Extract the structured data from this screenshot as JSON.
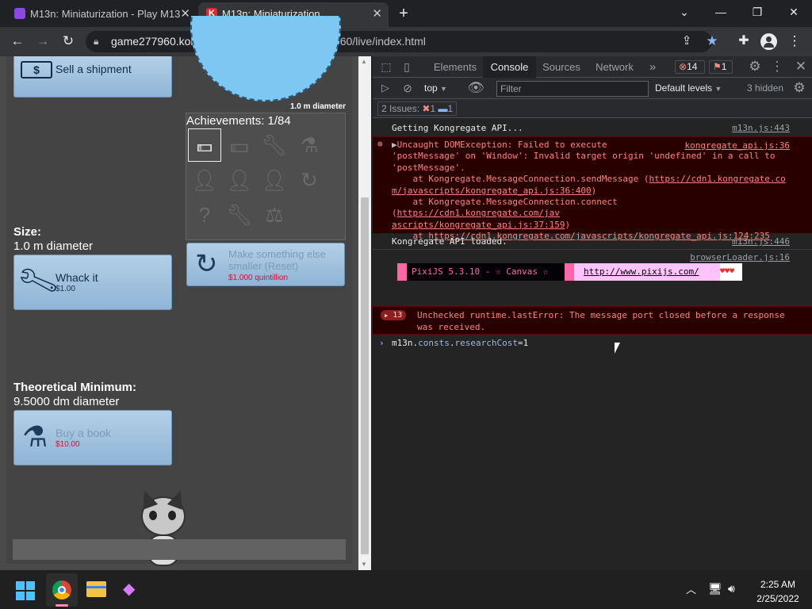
{
  "browser": {
    "tabs": [
      {
        "title": "M13n: Miniaturization - Play M13",
        "favicon_color": "#8c49e0"
      },
      {
        "title": "M13n: Miniaturization",
        "favicon_color": "#e02b2b"
      }
    ],
    "new_tab": "+",
    "url_host": "game277960.konggames.com",
    "url_path": "/gamez/0027/7960/live/index.html"
  },
  "game": {
    "sell_button": {
      "label": "Sell a shipment"
    },
    "circle_caption": "1.0 m diameter",
    "achievements_title": "Achievements: 1/84",
    "size_label": "Size:",
    "size_value": "1.0 m diameter",
    "whack_button": {
      "label": "Whack it",
      "cost": "$1.00"
    },
    "reset_button": {
      "label": "Make something else smaller (Reset)",
      "cost": "$1.000 quintillion"
    },
    "theoretical_label": "Theoretical Minimum:",
    "theoretical_value": "9.5000 dm diameter",
    "book_button": {
      "label": "Buy a book",
      "cost": "$10.00"
    }
  },
  "devtools": {
    "tabs": [
      "Elements",
      "Console",
      "Sources",
      "Network"
    ],
    "error_count": "14",
    "warning_count": "1",
    "context": "top",
    "filter_placeholder": "Filter",
    "levels": "Default levels",
    "hidden": "3 hidden",
    "issues_label": "2 Issues:",
    "issues_err": "1",
    "issues_info": "1",
    "messages": {
      "m1": {
        "text": "Getting Kongregate API...",
        "src": "m13n.js:443"
      },
      "m2": {
        "line1": "Uncaught DOMException: Failed to execute",
        "line2": "'postMessage' on 'Window': Invalid target origin 'undefined' in a call to",
        "line3": "'postMessage'.",
        "at1": "at Kongregate.MessageConnection.sendMessage (",
        "at1_link_a": "https://cdn1.kongregate.co",
        "at1_link_b": "m/javascripts/kongregate_api.js:36:400",
        "at1_end": ")",
        "at2": "at Kongregate.MessageConnection.connect (",
        "at2_link_a": "https://cdn1.kongregate.com/jav",
        "at2_link_b": "ascripts/kongregate_api.js:37:159",
        "at2_end": ")",
        "at3": "at ",
        "at3_link": "https://cdn1.kongregate.com/javascripts/kongregate_api.js:124:235",
        "src": "kongregate_api.js:36"
      },
      "m3": {
        "text": "Kongregate API loaded.",
        "src": "m13n.js:446"
      },
      "m4": {
        "src": "browserLoader.js:16",
        "pixi": "PixiJS 5.3.10 - ☆ Canvas ☆",
        "pixi_link": "http://www.pixijs.com/",
        "hearts": "♥♥♥"
      },
      "m5": {
        "count": "13",
        "line1": "Unchecked runtime.lastError: The message port closed before a response",
        "line2": "was received."
      },
      "input": {
        "obj": "m13n",
        "prop1": "consts",
        "prop2": "researchCost",
        "val": "=1"
      }
    }
  },
  "taskbar": {
    "time": "2:25 AM",
    "date": "2/25/2022"
  }
}
